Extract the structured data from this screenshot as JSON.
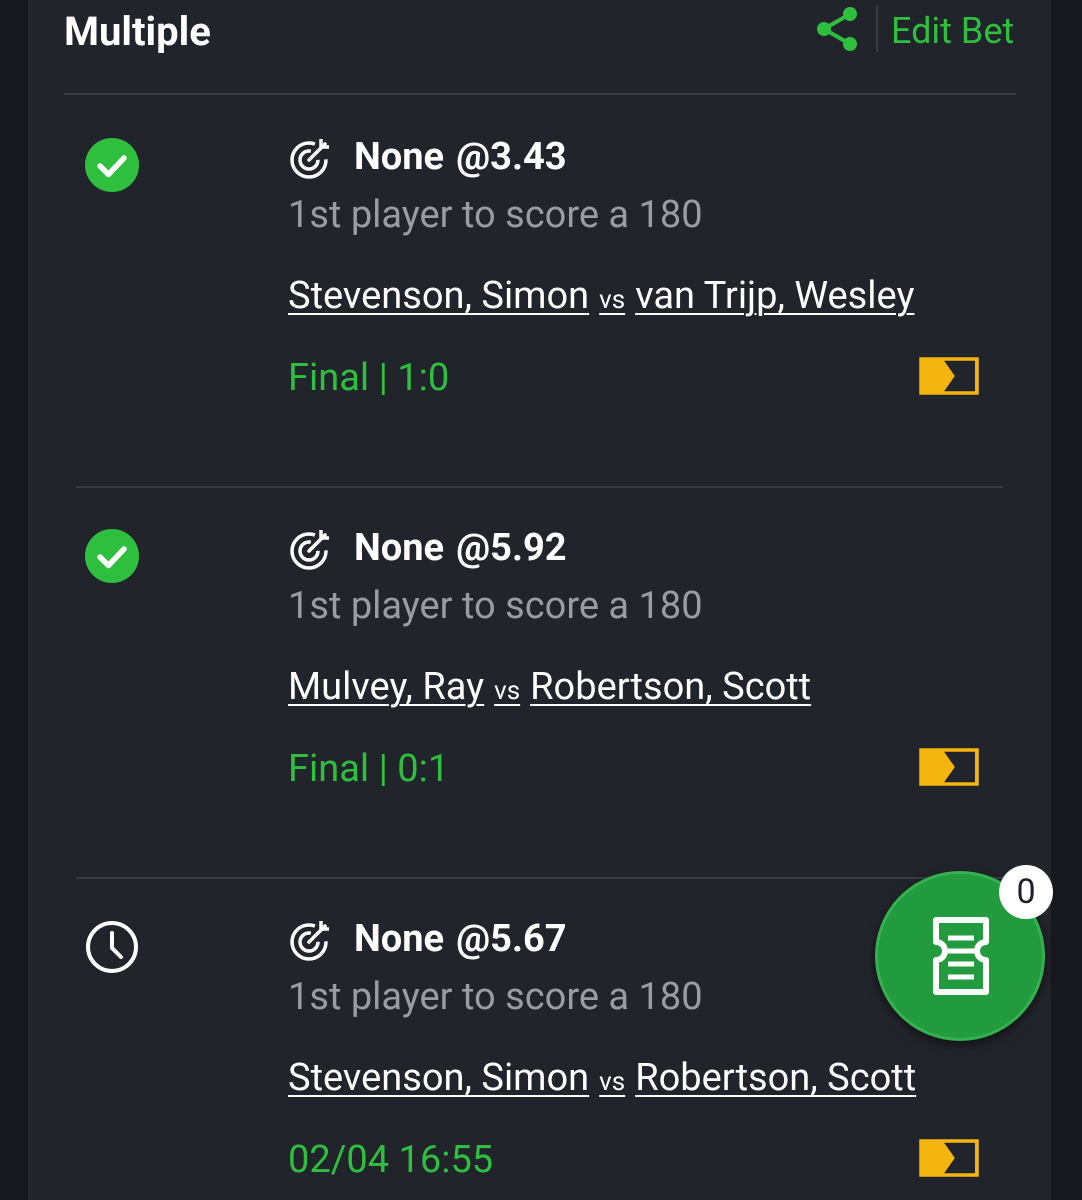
{
  "header": {
    "title": "Multiple",
    "edit_label": "Edit Bet"
  },
  "colors": {
    "background": "#22242b",
    "accent_green": "#2fbf3f",
    "stream_yellow": "#f5b50f",
    "fab_green": "#229a3e"
  },
  "selections": [
    {
      "status": "won",
      "pick": "None",
      "at": "@",
      "odds": "3.43",
      "market": "1st player to score a 180",
      "home": "Stevenson, Simon",
      "vs": "vs",
      "away": "van Trijp, Wesley",
      "result": "Final | 1:0"
    },
    {
      "status": "won",
      "pick": "None",
      "at": "@",
      "odds": "5.92",
      "market": "1st player to score a 180",
      "home": "Mulvey, Ray",
      "vs": "vs",
      "away": "Robertson, Scott",
      "result": "Final | 0:1"
    },
    {
      "status": "pending",
      "pick": "None",
      "at": "@",
      "odds": "5.67",
      "market": "1st player to score a 180",
      "home": "Stevenson, Simon",
      "vs": "vs",
      "away": "Robertson, Scott",
      "result": "02/04 16:55"
    }
  ],
  "betslip": {
    "count": "0"
  }
}
